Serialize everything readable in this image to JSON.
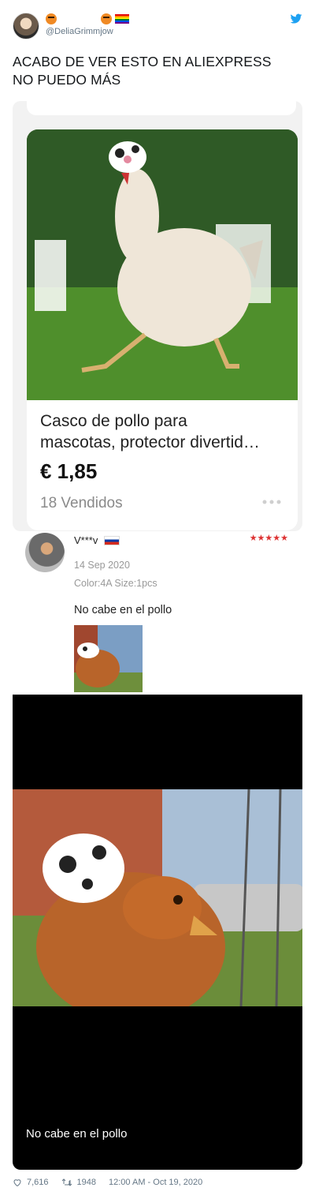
{
  "user": {
    "handle": "@DeliaGrimmjow"
  },
  "tweet": {
    "text_line1": "ACABO DE VER ESTO EN ALIEXPRESS",
    "text_line2": "NO PUEDO MÁS"
  },
  "product": {
    "title_line1": "Casco de pollo para",
    "title_line2": "mascotas, protector divertid…",
    "price": "€ 1,85",
    "sold": "18 Vendidos"
  },
  "review": {
    "name": "V***v",
    "stars": "★★★★★",
    "date": "14 Sep 2020",
    "details": "Color:4A Size:1pcs",
    "text": "No cabe en el pollo"
  },
  "photo_view": {
    "caption": "No cabe en el pollo"
  },
  "footer": {
    "likes": "7,616",
    "retweets": "1948",
    "timestamp": "12:00 AM - Oct 19, 2020"
  },
  "colors": {
    "twitter_blue": "#1da1f2",
    "star_red": "#d33333",
    "handle_gray": "#657786"
  }
}
